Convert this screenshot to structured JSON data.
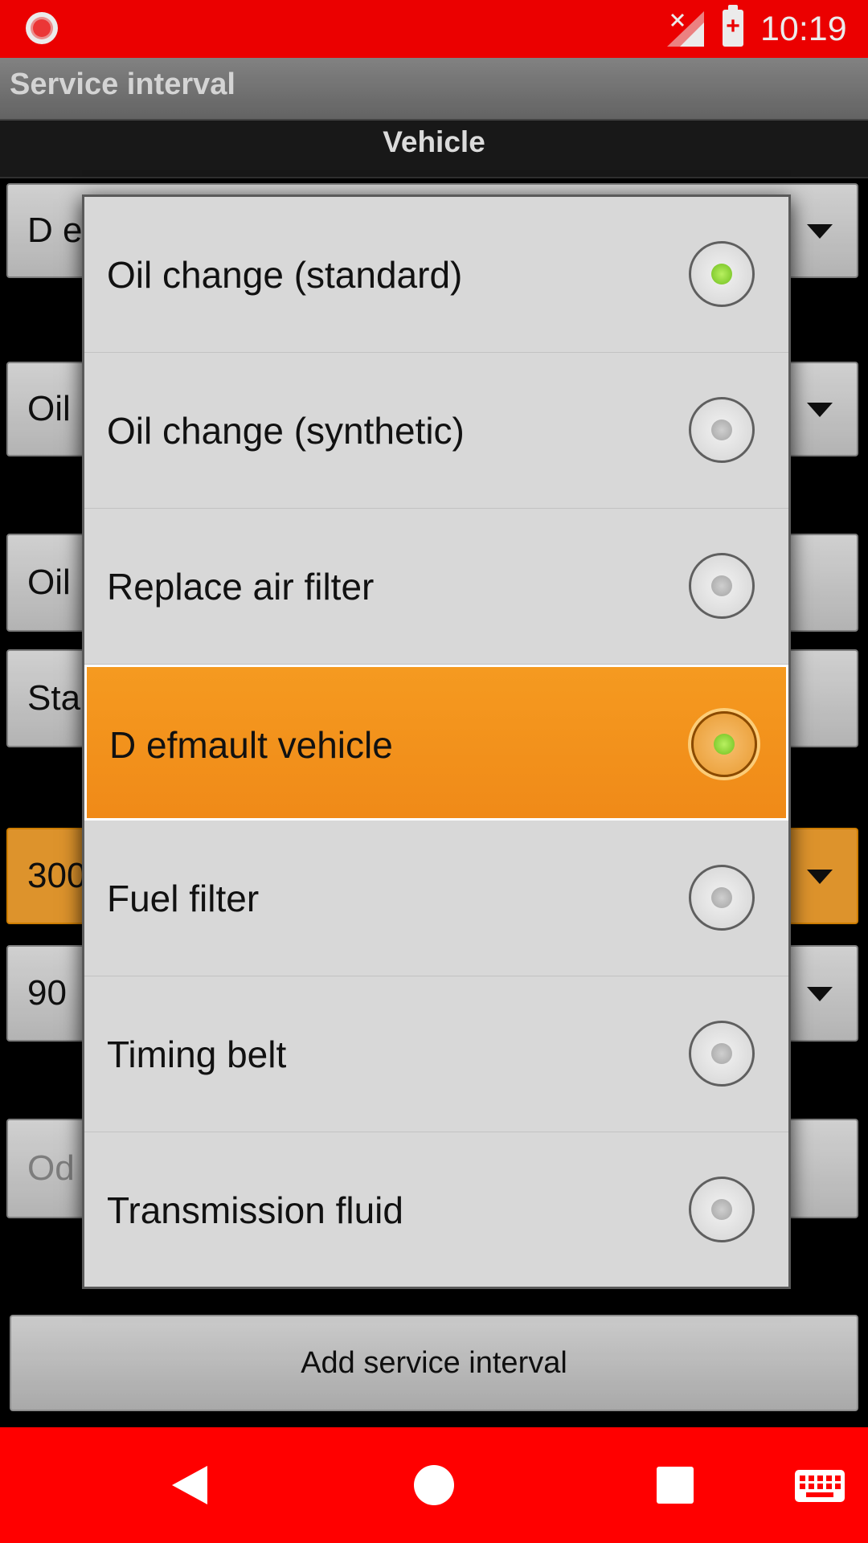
{
  "status_bar": {
    "time": "10:19",
    "icons": [
      "record-icon",
      "signal-off-icon",
      "battery-charging-icon"
    ],
    "color": "#ff0000"
  },
  "app_bar": {
    "title": "Service interval"
  },
  "form": {
    "section_header": "Vehicle",
    "fields": [
      {
        "value": "D e",
        "type": "dropdown"
      },
      {
        "value": "Oil",
        "type": "dropdown"
      },
      {
        "value": "Oil",
        "type": "text"
      },
      {
        "value": "Sta",
        "type": "text"
      },
      {
        "value": "300",
        "type": "dropdown",
        "focused": true
      },
      {
        "value": "90",
        "type": "dropdown"
      },
      {
        "value": "Od",
        "type": "text",
        "placeholder": true
      }
    ],
    "add_button_label": "Add service interval"
  },
  "dialog": {
    "options": [
      {
        "label": "Oil change (standard)",
        "checked": true
      },
      {
        "label": "Oil change (synthetic)",
        "checked": false
      },
      {
        "label": "Replace air filter",
        "checked": false
      },
      {
        "label": "D efmault vehicle",
        "checked": true,
        "highlighted": true
      },
      {
        "label": "Fuel filter",
        "checked": false
      },
      {
        "label": "Timing belt",
        "checked": false
      },
      {
        "label": "Transmission fluid",
        "checked": false
      }
    ],
    "highlight_color": "#f39020",
    "radio_checked_color": "#7cc72a"
  },
  "nav_bar": {
    "icons": [
      "back-icon",
      "home-icon",
      "recents-icon",
      "keyboard-icon"
    ],
    "color": "#ff0000"
  }
}
